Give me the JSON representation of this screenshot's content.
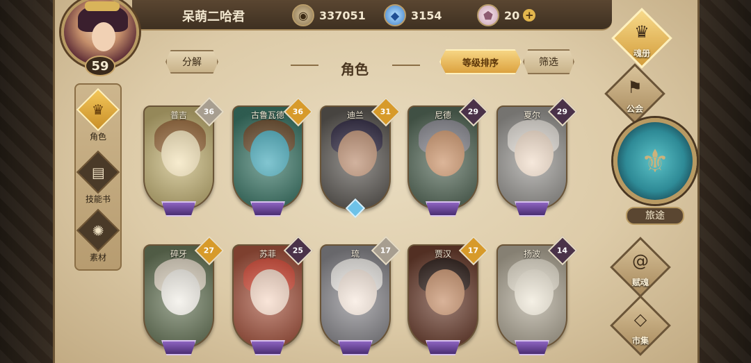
{
  "player": {
    "name": "呆萌二哈君",
    "level": "59"
  },
  "resources": [
    {
      "icon": "gold-coin-icon",
      "glyph": "◉",
      "value": "337051"
    },
    {
      "icon": "blue-crystal-icon",
      "glyph": "◆",
      "value": "3154"
    },
    {
      "icon": "pink-gem-icon",
      "glyph": "⬟",
      "value": "20"
    }
  ],
  "plus_symbol": "+",
  "left_tabs": [
    {
      "label": "角色",
      "glyph": "♛",
      "icon": "helmet-icon",
      "active": true
    },
    {
      "label": "技能书",
      "glyph": "▤",
      "icon": "skill-book-icon",
      "active": false
    },
    {
      "label": "素材",
      "glyph": "✺",
      "icon": "material-icon",
      "active": false
    }
  ],
  "header": {
    "decompose": "分解",
    "title": "角色",
    "sort": "等级排序",
    "filter": "筛选"
  },
  "cards": [
    {
      "name": "普吉",
      "level": "36",
      "badge": "white",
      "rank": "purple",
      "bg": "#c7b677",
      "skin": "#f3e2b5",
      "hair": "#9a6a3a"
    },
    {
      "name": "古鲁瓦德",
      "level": "36",
      "badge": "gold",
      "rank": "purple",
      "bg": "#3d7a6a",
      "skin": "#3fa7b8",
      "hair": "#6b4b2a"
    },
    {
      "name": "迪兰",
      "level": "31",
      "badge": "gold",
      "rank": "blue",
      "bg": "#5f5b56",
      "skin": "#b9896a",
      "hair": "#2d2640"
    },
    {
      "name": "尼德",
      "level": "29",
      "badge": "purple",
      "rank": "purple",
      "bg": "#566b5a",
      "skin": "#c98e62",
      "hair": "#8a8a92"
    },
    {
      "name": "夏尔",
      "level": "29",
      "badge": "purple",
      "rank": "purple",
      "bg": "#9c9a96",
      "skin": "#f1dcc8",
      "hair": "#e6e1da"
    },
    {
      "name": "碎牙",
      "level": "27",
      "badge": "gold",
      "rank": "purple",
      "bg": "#6b7a5c",
      "skin": "#f1eee6",
      "hair": "#e3d9c6"
    },
    {
      "name": "苏菲",
      "level": "25",
      "badge": "purple",
      "rank": "purple",
      "bg": "#a8553f",
      "skin": "#f6d7c4",
      "hair": "#d84a36"
    },
    {
      "name": "琉",
      "level": "17",
      "badge": "white",
      "rank": "purple",
      "bg": "#8b8a8f",
      "skin": "#f7e8dc",
      "hair": "#f1eeea"
    },
    {
      "name": "贾汉",
      "level": "17",
      "badge": "gold",
      "rank": "purple",
      "bg": "#6d3f2f",
      "skin": "#c48a62",
      "hair": "#2b1b16"
    },
    {
      "name": "扬波",
      "level": "14",
      "badge": "purple",
      "rank": "purple",
      "bg": "#b3ab99",
      "skin": "#efe8d7",
      "hair": "#e7e0cf"
    }
  ],
  "right_nav": {
    "soul_book": "魂册",
    "guild": "公会",
    "journey": "旅途",
    "soul_gift": "赋魂",
    "market": "市集"
  },
  "colors": {
    "accent_gold": "#dca23f",
    "parchment": "#e9dcc0",
    "dark_brown": "#3e3021"
  }
}
